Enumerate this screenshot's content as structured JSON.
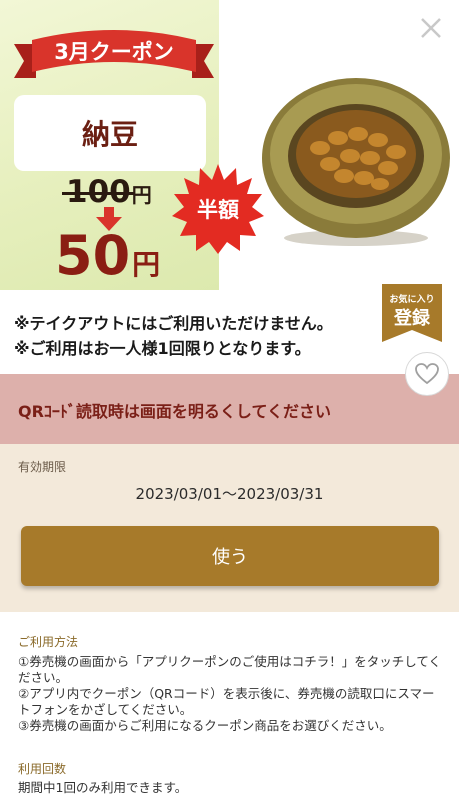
{
  "coupon": {
    "banner": "3月クーポン",
    "item_name": "納豆",
    "old_price": "100",
    "new_price": "50",
    "currency": "円",
    "badge": "半額"
  },
  "notes": [
    "※テイクアウトにはご利用いただけません。",
    "※ご利用はお一人様1回限りとなります。"
  ],
  "favorite": {
    "small": "お気に入り",
    "big": "登録"
  },
  "qr_notice": "QRｺｰﾄﾞ読取時は画面を明るくしてください",
  "validity": {
    "label": "有効期限",
    "value": "2023/03/01〜2023/03/31"
  },
  "use_button": "使う",
  "how_to": {
    "label": "ご利用方法",
    "steps": [
      "①券売機の画面から「アプリクーポンのご使用はコチラ！」をタッチしてください。",
      "②アプリ内でクーポン（QRコード）を表示後に、券売機の読取口にスマートフォンをかざしてください。",
      "③券売機の画面からご利用になるクーポン商品をお選びください。"
    ]
  },
  "usage_count": {
    "label": "利用回数",
    "value": "期間中1回のみ利用できます。"
  },
  "icons": [
    "close-icon",
    "heart-icon",
    "arrow-down-icon"
  ],
  "colors": {
    "brand_red": "#d9342b",
    "dark_red": "#8a1e13",
    "gold": "#a77a2a",
    "qr_bar": "#ddb0ab"
  }
}
